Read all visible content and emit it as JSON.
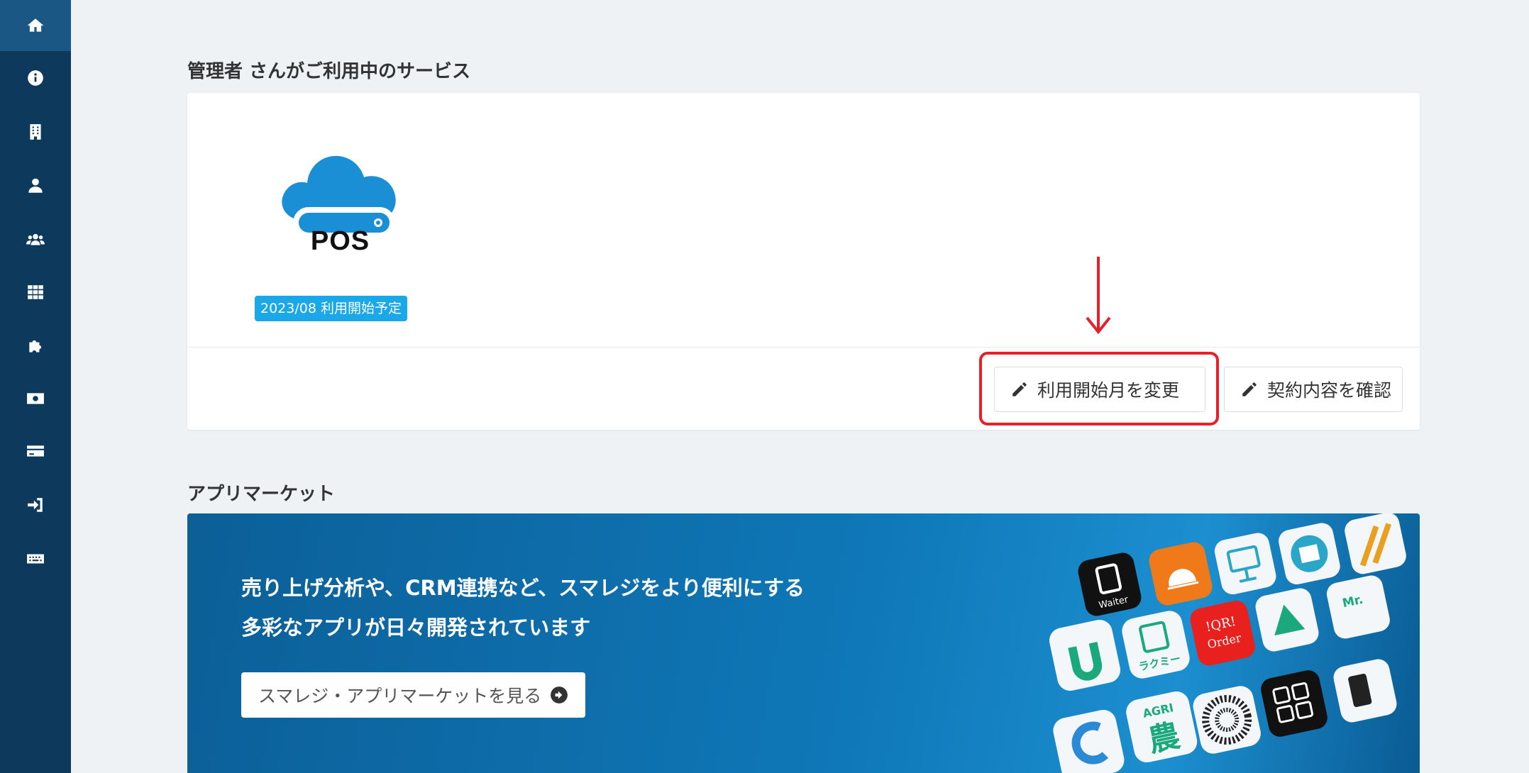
{
  "sidebar": {
    "items": [
      {
        "icon": "home-icon",
        "active": true
      },
      {
        "icon": "info-icon"
      },
      {
        "icon": "building-icon"
      },
      {
        "icon": "user-icon"
      },
      {
        "icon": "users-icon"
      },
      {
        "icon": "grid-icon"
      },
      {
        "icon": "puzzle-icon"
      },
      {
        "icon": "money-icon"
      },
      {
        "icon": "credit-card-icon"
      },
      {
        "icon": "sign-in-icon"
      },
      {
        "icon": "keyboard-icon"
      }
    ]
  },
  "services": {
    "heading": "管理者 さんがご利用中のサービス",
    "pos": {
      "name": "POS",
      "status_badge": "2023/08 利用開始予定"
    },
    "actions": {
      "change_start_month": "利用開始月を変更",
      "view_contract": "契約内容を確認"
    }
  },
  "app_market": {
    "heading": "アプリマーケット",
    "line1": "売り上げ分析や、CRM連携など、スマレジをより便利にする",
    "line2": "多彩なアプリが日々開発されています",
    "button_label": "スマレジ・アプリマーケットを見る",
    "app_labels": {
      "waiter": "Waiter",
      "rakumi": "ラクミー",
      "qr_order_top": "!QR!",
      "qr_order_bottom": "Order",
      "agri": "AGRI",
      "agri_kanji": "農",
      "mr": "Mr."
    }
  },
  "colors": {
    "sidebar": "#0d3a5c",
    "sidebar_active": "#1a5784",
    "badge": "#1aa8e8",
    "highlight": "#e8202a",
    "pos_cloud": "#1a8fd6"
  }
}
